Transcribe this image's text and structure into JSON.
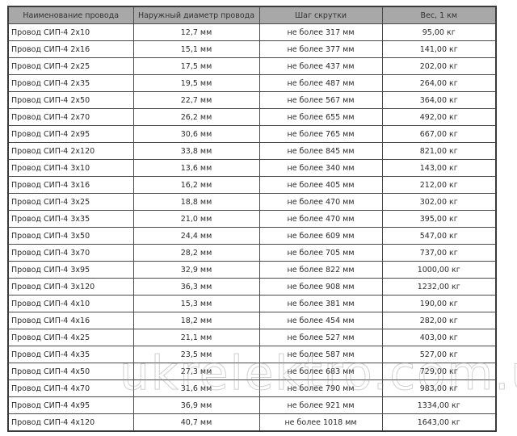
{
  "table": {
    "headers": [
      "Наименование провода",
      "Наружный диаметр провода",
      "Шаг скрутки",
      "Вес, 1 км"
    ],
    "rows": [
      [
        "Провод СИП-4 2х10",
        "12,7 мм",
        "не более 317 мм",
        "95,00 кг"
      ],
      [
        "Провод СИП-4 2х16",
        "15,1 мм",
        "не более 377 мм",
        "141,00 кг"
      ],
      [
        "Провод СИП-4 2х25",
        "17,5 мм",
        "не более 437 мм",
        "202,00 кг"
      ],
      [
        "Провод СИП-4 2х35",
        "19,5 мм",
        "не более 487 мм",
        "264,00 кг"
      ],
      [
        "Провод СИП-4 2х50",
        "22,7 мм",
        "не более 567 мм",
        "364,00 кг"
      ],
      [
        "Провод СИП-4 2х70",
        "26,2 мм",
        "не более 655 мм",
        "492,00 кг"
      ],
      [
        "Провод СИП-4 2х95",
        "30,6 мм",
        "не более 765 мм",
        "667,00 кг"
      ],
      [
        "Провод СИП-4 2х120",
        "33,8 мм",
        "не более 845 мм",
        "821,00 кг"
      ],
      [
        "Провод СИП-4 3х10",
        "13,6 мм",
        "не более 340 мм",
        "143,00 кг"
      ],
      [
        "Провод СИП-4 3х16",
        "16,2 мм",
        "не более 405 мм",
        "212,00 кг"
      ],
      [
        "Провод СИП-4 3х25",
        "18,8 мм",
        "не более 470 мм",
        "302,00 кг"
      ],
      [
        "Провод СИП-4 3х35",
        "21,0 мм",
        "не более 470 мм",
        "395,00 кг"
      ],
      [
        "Провод СИП-4 3х50",
        "24,4 мм",
        "не более 609 мм",
        "547,00 кг"
      ],
      [
        "Провод СИП-4 3х70",
        "28,2 мм",
        "не более 705 мм",
        "737,00 кг"
      ],
      [
        "Провод СИП-4 3х95",
        "32,9 мм",
        "не более 822 мм",
        "1000,00 кг"
      ],
      [
        "Провод СИП-4 3х120",
        "36,3 мм",
        "не более 908 мм",
        "1232,00 кг"
      ],
      [
        "Провод СИП-4 4х10",
        "15,3 мм",
        "не более 381 мм",
        "190,00 кг"
      ],
      [
        "Провод СИП-4 4х16",
        "18,2 мм",
        "не более 454 мм",
        "282,00 кг"
      ],
      [
        "Провод СИП-4 4х25",
        "21,1 мм",
        "не более 527 мм",
        "403,00 кг"
      ],
      [
        "Провод СИП-4 4х35",
        "23,5 мм",
        "не более 587 мм",
        "527,00 кг"
      ],
      [
        "Провод СИП-4 4х50",
        "27,3 мм",
        "не более 683 мм",
        "729,00 кг"
      ],
      [
        "Провод СИП-4 4х70",
        "31,6 мм",
        "не более 790 мм",
        "983,00 кг"
      ],
      [
        "Провод СИП-4 4х95",
        "36,9 мм",
        "не более 921 мм",
        "1334,00 кг"
      ],
      [
        "Провод СИП-4 4х120",
        "40,7 мм",
        "не более 1018 мм",
        "1643,00 кг"
      ]
    ]
  },
  "watermark": "ukrelektro.com.ua",
  "colors": {
    "header_bg": "#a8a8a8",
    "border": "#4a4a4a",
    "text": "#2b2b2b"
  }
}
